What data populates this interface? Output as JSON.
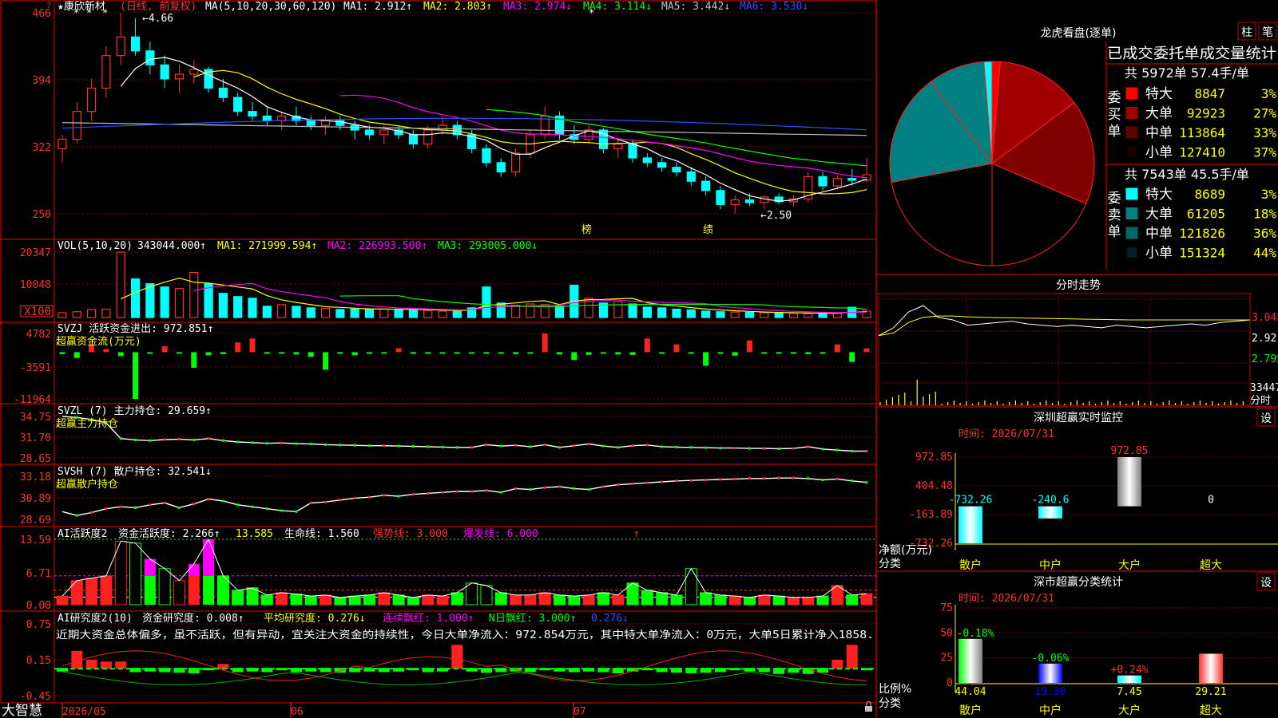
{
  "left": {
    "corner_mark": "?",
    "kline": {
      "stock_name": "★康欣新材",
      "period_label": "(日线, 前复权)",
      "ma_header": "MA(5,10,20,30,60,120)",
      "ma_values": [
        {
          "label": "MA1: 2.912↑",
          "color": "#ffffff"
        },
        {
          "label": "MA2: 2.803↑",
          "color": "#ffff00"
        },
        {
          "label": "MA3: 2.974↓",
          "color": "#ff00ff"
        },
        {
          "label": "MA4: 3.114↓",
          "color": "#00ff00"
        },
        {
          "label": "MA5: 3.442↓",
          "color": "#c0c0c0"
        },
        {
          "label": "MA6: 3.530↓",
          "color": "#3050ff"
        }
      ],
      "y_ticks": [
        "466",
        "394",
        "322",
        "250"
      ],
      "high_note": "←4.66",
      "low_note": "←2.50",
      "event_marks": [
        "榜",
        "绩"
      ]
    },
    "vol": {
      "header": "VOL(5,10,20)",
      "values": [
        {
          "label": "343044.000↑",
          "color": "#ffffff"
        },
        {
          "label": "MA1: 271999.594↑",
          "color": "#ffff00"
        },
        {
          "label": "MA2: 226993.500↑",
          "color": "#ff00ff"
        },
        {
          "label": "MA3: 293005.000↓",
          "color": "#00ff00"
        }
      ],
      "y_ticks": [
        "20347",
        "10048"
      ],
      "unit": "X100"
    },
    "svzj": {
      "header": "SVZJ  活跃资金进出: 972.851↑",
      "sub": "超赢资金流(万元)",
      "y_ticks": [
        "4782",
        "-3591",
        "-11964"
      ]
    },
    "svzl": {
      "header": "SVZL (7) 主力持仓: 29.659↑",
      "sub": "超赢主力持仓",
      "y_ticks": [
        "34.75",
        "31.70",
        "28.65"
      ]
    },
    "svsh": {
      "header": "SVSH (7) 散户持仓: 32.541↓",
      "sub": "超赢散户持仓",
      "y_ticks": [
        "33.18",
        "30.89",
        "28.69"
      ]
    },
    "ai1": {
      "title": "AI活跃度2",
      "items": [
        {
          "label": "资金活跃度: 2.266↑",
          "color": "#ffffff"
        },
        {
          "label": "13.585",
          "color": "#ffff00"
        },
        {
          "label": "生命线: 1.560",
          "color": "#ffffff"
        },
        {
          "label": "强势线: 3.000",
          "color": "#ff3030"
        },
        {
          "label": "爆发线: 6.000",
          "color": "#ff00ff"
        }
      ],
      "y_ticks": [
        "13.59",
        "6.71",
        "0.00"
      ]
    },
    "ai2": {
      "title": "AI研究度2(10)",
      "items": [
        {
          "label": "资金研究度: 0.008↑",
          "color": "#ffffff"
        },
        {
          "label": "平均研究度: 0.276↓",
          "color": "#ffff00"
        },
        {
          "label": "连续飘红: 1.000↑",
          "color": "#ff00ff"
        },
        {
          "label": "N日飘红: 3.000↑",
          "color": "#00ff00"
        },
        {
          "label": "0.276↓",
          "color": "#3050ff"
        }
      ],
      "commentary": "近期大资金总体偏多，虽不活跃，但有异动，宜关注大资金的持续性，今日大单净流入：972.854万元，其中特大单净流入：0万元，大单5日累计净入1858.",
      "y_ticks": [
        "0.75",
        "0.15",
        "-0.45"
      ]
    },
    "date_axis": [
      "2026/05",
      "06",
      "07"
    ],
    "brand": "大智慧"
  },
  "right": {
    "longhu": {
      "title": "龙虎看盘(逐单)",
      "btn_bar": "柱",
      "btn_stroke": "笔",
      "table_header": "已成交委托单成交量统计",
      "buy": {
        "side_label": "委买单",
        "summary": "共 5972单 57.4手/单",
        "rows": [
          {
            "name": "特大",
            "value": "8847",
            "pct": "3%",
            "color": "#ff0000"
          },
          {
            "name": "大单",
            "value": "92923",
            "pct": "27%",
            "color": "#a00000"
          },
          {
            "name": "中单",
            "value": "113864",
            "pct": "33%",
            "color": "#600000"
          },
          {
            "name": "小单",
            "value": "127410",
            "pct": "37%",
            "color": "#1a0000"
          }
        ]
      },
      "sell": {
        "side_label": "委卖单",
        "summary": "共 7543单 45.5手/单",
        "rows": [
          {
            "name": "特大",
            "value": "8689",
            "pct": "3%",
            "color": "#00ffff"
          },
          {
            "name": "大单",
            "value": "61205",
            "pct": "18%",
            "color": "#008080"
          },
          {
            "name": "中单",
            "value": "121826",
            "pct": "36%",
            "color": "#006868"
          },
          {
            "name": "小单",
            "value": "151324",
            "pct": "44%",
            "color": "#002020"
          }
        ]
      }
    },
    "intraday": {
      "title": "分时走势",
      "y_ticks": [
        "3.045",
        "2.920",
        "2.795"
      ],
      "vol_label": "33447",
      "time_label": "分时"
    },
    "monitor": {
      "title": "深圳超赢实时监控",
      "setting": "设",
      "time": "时间: 2026/07/31",
      "y_ticks": [
        "972.85",
        "404.48",
        "-163.89",
        "-732.26"
      ],
      "axis_label": "净额(万元)",
      "cat_label": "分类",
      "bar_labels": [
        "-732.26",
        "-240.6",
        "972.85",
        "0"
      ],
      "categories": [
        "散户",
        "中户",
        "大户",
        "超大"
      ]
    },
    "classify": {
      "title": "深市超赢分类统计",
      "setting": "设",
      "time": "时间: 2026/07/31",
      "y_ticks": [
        "75",
        "50",
        "25",
        "0"
      ],
      "axis_label": "比例%",
      "cat_label": "分类",
      "top_labels": [
        "-0.18%",
        "-0.06%",
        "+0.24%",
        ""
      ],
      "bottom_labels": [
        "44.04",
        "19.30",
        "7.45",
        "29.21"
      ],
      "categories": [
        "散户",
        "中户",
        "大户",
        "超大"
      ]
    }
  },
  "chart_data": [
    {
      "type": "candlestick",
      "title": "★康欣新材 (日线, 前复权)",
      "ylim": [
        2.5,
        4.66
      ],
      "y_ticks": [
        4.66,
        3.94,
        3.22,
        2.5
      ],
      "x_labels": [
        "2026/05",
        "06",
        "07"
      ],
      "ohlc": [
        [
          3.2,
          3.35,
          3.05,
          3.3
        ],
        [
          3.3,
          3.7,
          3.25,
          3.6
        ],
        [
          3.6,
          3.95,
          3.5,
          3.85
        ],
        [
          3.85,
          4.3,
          3.75,
          4.2
        ],
        [
          4.2,
          4.66,
          4.1,
          4.4
        ],
        [
          4.4,
          4.6,
          4.2,
          4.25
        ],
        [
          4.25,
          4.35,
          4.0,
          4.1
        ],
        [
          4.1,
          4.2,
          3.85,
          3.95
        ],
        [
          3.95,
          4.1,
          3.8,
          4.0
        ],
        [
          4.0,
          4.15,
          3.9,
          4.05
        ],
        [
          4.05,
          4.08,
          3.8,
          3.85
        ],
        [
          3.85,
          3.95,
          3.7,
          3.75
        ],
        [
          3.75,
          3.8,
          3.55,
          3.6
        ],
        [
          3.6,
          3.7,
          3.5,
          3.55
        ],
        [
          3.55,
          3.65,
          3.45,
          3.5
        ],
        [
          3.5,
          3.6,
          3.4,
          3.55
        ],
        [
          3.55,
          3.65,
          3.45,
          3.5
        ],
        [
          3.5,
          3.55,
          3.4,
          3.45
        ],
        [
          3.45,
          3.55,
          3.35,
          3.5
        ],
        [
          3.5,
          3.55,
          3.4,
          3.45
        ],
        [
          3.45,
          3.5,
          3.3,
          3.4
        ],
        [
          3.4,
          3.45,
          3.3,
          3.35
        ],
        [
          3.35,
          3.45,
          3.25,
          3.4
        ],
        [
          3.4,
          3.45,
          3.3,
          3.35
        ],
        [
          3.35,
          3.4,
          3.2,
          3.25
        ],
        [
          3.25,
          3.45,
          3.2,
          3.4
        ],
        [
          3.4,
          3.55,
          3.35,
          3.45
        ],
        [
          3.45,
          3.5,
          3.3,
          3.35
        ],
        [
          3.35,
          3.4,
          3.15,
          3.2
        ],
        [
          3.2,
          3.25,
          3.0,
          3.05
        ],
        [
          3.05,
          3.1,
          2.9,
          2.95
        ],
        [
          2.95,
          3.2,
          2.9,
          3.15
        ],
        [
          3.15,
          3.4,
          3.1,
          3.35
        ],
        [
          3.35,
          3.65,
          3.3,
          3.55
        ],
        [
          3.55,
          3.6,
          3.3,
          3.35
        ],
        [
          3.35,
          3.45,
          3.25,
          3.3
        ],
        [
          3.3,
          3.45,
          3.25,
          3.4
        ],
        [
          3.4,
          3.42,
          3.15,
          3.2
        ],
        [
          3.2,
          3.3,
          3.1,
          3.25
        ],
        [
          3.25,
          3.3,
          3.05,
          3.1
        ],
        [
          3.1,
          3.15,
          3.0,
          3.05
        ],
        [
          3.05,
          3.1,
          2.95,
          3.0
        ],
        [
          3.0,
          3.05,
          2.9,
          2.95
        ],
        [
          2.95,
          3.0,
          2.8,
          2.85
        ],
        [
          2.85,
          2.9,
          2.7,
          2.75
        ],
        [
          2.75,
          2.8,
          2.55,
          2.6
        ],
        [
          2.6,
          2.7,
          2.5,
          2.65
        ],
        [
          2.65,
          2.72,
          2.58,
          2.62
        ],
        [
          2.62,
          2.7,
          2.55,
          2.68
        ],
        [
          2.68,
          2.72,
          2.6,
          2.63
        ],
        [
          2.63,
          2.7,
          2.58,
          2.66
        ],
        [
          2.66,
          2.95,
          2.62,
          2.9
        ],
        [
          2.9,
          2.95,
          2.75,
          2.8
        ],
        [
          2.8,
          2.92,
          2.76,
          2.88
        ],
        [
          2.88,
          2.98,
          2.8,
          2.86
        ],
        [
          2.86,
          3.1,
          2.84,
          2.92
        ]
      ]
    },
    {
      "type": "bar",
      "title": "VOL(5,10,20)",
      "ylabel": "X100",
      "ylim": [
        0,
        20347
      ],
      "values": [
        1500,
        1800,
        2500,
        2600,
        20347,
        12000,
        10500,
        9500,
        9000,
        14000,
        10500,
        7500,
        6500,
        6000,
        3500,
        4000,
        3500,
        3000,
        2800,
        2500,
        2700,
        2500,
        2600,
        2500,
        2400,
        2200,
        2000,
        1900,
        3000,
        9500,
        4500,
        3800,
        4200,
        4000,
        3600,
        10048,
        6000,
        4500,
        5000,
        4200,
        3200,
        3000,
        2600,
        2400,
        2000,
        1800,
        1700,
        1600,
        1500,
        1400,
        1300,
        1200,
        1300,
        1400,
        3200,
        2000
      ]
    },
    {
      "type": "bar",
      "title": "SVZJ 活跃资金进出",
      "ylabel": "超赢资金流(万元)",
      "ylim": [
        -11964,
        4782
      ],
      "values": [
        -500,
        -1500,
        2000,
        800,
        -1000,
        -11964,
        -400,
        1500,
        -300,
        -4000,
        -800,
        -500,
        2500,
        3500,
        -400,
        -300,
        -600,
        -1200,
        -4500,
        -300,
        -800,
        -200,
        -400,
        1000,
        -300,
        -300,
        -200,
        -100,
        -400,
        -300,
        -200,
        -500,
        -300,
        4782,
        -600,
        -2000,
        -700,
        -300,
        -600,
        -700,
        3500,
        -300,
        2000,
        -300,
        -3500,
        -400,
        -900,
        3000,
        -300,
        -200,
        -400,
        -500,
        -300,
        2000,
        -2500,
        972
      ]
    },
    {
      "type": "line",
      "title": "SVZL (7) 主力持仓",
      "ylim": [
        28.65,
        34.75
      ],
      "values": [
        34.75,
        34.6,
        34.3,
        33.8,
        31.5,
        31.3,
        31.2,
        31.35,
        31.4,
        31.3,
        31.5,
        31.2,
        31.0,
        30.9,
        30.8,
        30.85,
        30.75,
        30.7,
        30.6,
        30.55,
        30.5,
        30.45,
        30.45,
        30.4,
        30.35,
        30.3,
        30.25,
        30.2,
        30.2,
        30.6,
        30.4,
        30.5,
        30.3,
        30.6,
        30.2,
        30.45,
        30.7,
        30.4,
        30.2,
        30.45,
        30.55,
        30.3,
        30.25,
        30.2,
        30.15,
        30.1,
        30.1,
        30.05,
        30.05,
        30.0,
        30.05,
        30.3,
        29.95,
        29.8,
        29.65,
        29.66
      ]
    },
    {
      "type": "line",
      "title": "SVSH (7) 散户持仓",
      "ylim": [
        28.69,
        33.18
      ],
      "values": [
        29.5,
        29.1,
        29.4,
        29.8,
        30.0,
        29.9,
        30.2,
        30.4,
        29.9,
        30.3,
        30.8,
        30.6,
        30.2,
        30.0,
        29.8,
        29.6,
        29.5,
        30.4,
        30.5,
        30.7,
        30.9,
        31.0,
        31.2,
        31.1,
        31.3,
        31.4,
        31.5,
        31.6,
        31.6,
        31.7,
        31.5,
        31.9,
        31.8,
        32.0,
        32.1,
        31.9,
        31.8,
        32.1,
        32.3,
        32.4,
        32.5,
        32.6,
        32.7,
        32.75,
        32.8,
        32.85,
        32.9,
        32.95,
        32.95,
        33.0,
        33.0,
        32.95,
        32.8,
        32.9,
        32.7,
        32.54
      ]
    },
    {
      "type": "bar",
      "title": "AI活跃度2",
      "ylim": [
        0,
        13.59
      ],
      "values": [
        1.8,
        5.0,
        5.5,
        6.0,
        13.2,
        12.8,
        9.5,
        7.5,
        5.0,
        8.5,
        13.59,
        6.0,
        3.0,
        3.5,
        2.0,
        2.5,
        2.2,
        1.8,
        2.0,
        1.5,
        1.8,
        2.0,
        2.5,
        2.0,
        1.5,
        2.0,
        1.8,
        2.5,
        4.5,
        4.0,
        2.5,
        2.0,
        2.0,
        2.5,
        2.0,
        1.8,
        2.0,
        2.5,
        2.0,
        4.5,
        3.0,
        2.5,
        2.0,
        7.5,
        2.5,
        2.0,
        1.8,
        1.5,
        2.0,
        1.8,
        1.5,
        1.5,
        1.8,
        4.0,
        2.0,
        2.3
      ]
    },
    {
      "type": "bar",
      "title": "AI研究度2(10)",
      "ylim": [
        -0.45,
        0.75
      ],
      "values": [
        -0.02,
        0.3,
        0.15,
        0.12,
        0.12,
        -0.03,
        -0.02,
        -0.03,
        -0.04,
        -0.05,
        0.05,
        0.08,
        -0.03,
        -0.02,
        -0.03,
        0.01,
        -0.03,
        -0.02,
        -0.03,
        -0.04,
        -0.03,
        -0.02,
        -0.03,
        -0.02,
        0.01,
        -0.03,
        -0.02,
        0.4,
        -0.02,
        -0.04,
        -0.03,
        -0.02,
        -0.03,
        0.03,
        -0.02,
        -0.03,
        -0.02,
        -0.03,
        -0.05,
        -0.02,
        0.05,
        -0.03,
        -0.04,
        -0.05,
        -0.04,
        -0.03,
        0.05,
        -0.02,
        -0.03,
        -0.06,
        -0.04,
        -0.06,
        -0.04,
        0.15,
        0.4,
        0.008
      ]
    },
    {
      "type": "pie",
      "title": "龙虎看盘(逐单)",
      "labels": [
        "买特大",
        "买大单",
        "买中单",
        "买小单",
        "卖小单",
        "卖中单",
        "卖大单",
        "卖特大"
      ],
      "values": [
        8847,
        92923,
        113864,
        127410,
        151324,
        121826,
        61205,
        8689
      ]
    },
    {
      "type": "line",
      "title": "分时走势",
      "ylim": [
        2.795,
        3.045
      ],
      "y_ticks": [
        3.045,
        2.92,
        2.795
      ],
      "series": [
        {
          "values": [
            2.93,
            2.96,
            3.02,
            3.045,
            3.0,
            2.99,
            2.97,
            2.975,
            2.98,
            2.985,
            2.975,
            2.97,
            2.965,
            2.97,
            2.965,
            2.96,
            2.97,
            2.965,
            2.96,
            2.965,
            2.97,
            2.975,
            2.97,
            2.98,
            2.985,
            2.99
          ]
        },
        {
          "values": [
            2.93,
            2.94,
            2.98,
            3.0,
            3.005,
            3.005,
            3.002,
            3.0,
            2.999,
            2.998,
            2.997,
            2.996,
            2.995,
            2.994,
            2.993,
            2.992,
            2.991,
            2.99,
            2.99,
            2.99,
            2.99,
            2.99,
            2.99,
            2.99,
            2.99,
            2.99
          ]
        }
      ]
    },
    {
      "type": "bar",
      "title": "深圳超赢实时监控",
      "ylabel": "净额(万元)",
      "categories": [
        "散户",
        "中户",
        "大户",
        "超大"
      ],
      "values": [
        -732.26,
        -240.6,
        972.85,
        0
      ],
      "ylim": [
        -732.26,
        972.85
      ]
    },
    {
      "type": "bar",
      "title": "深市超赢分类统计",
      "ylabel": "比例%",
      "categories": [
        "散户",
        "中户",
        "大户",
        "超大"
      ],
      "values": [
        44.04,
        19.3,
        7.45,
        29.21
      ],
      "ylim": [
        0,
        75
      ]
    }
  ]
}
